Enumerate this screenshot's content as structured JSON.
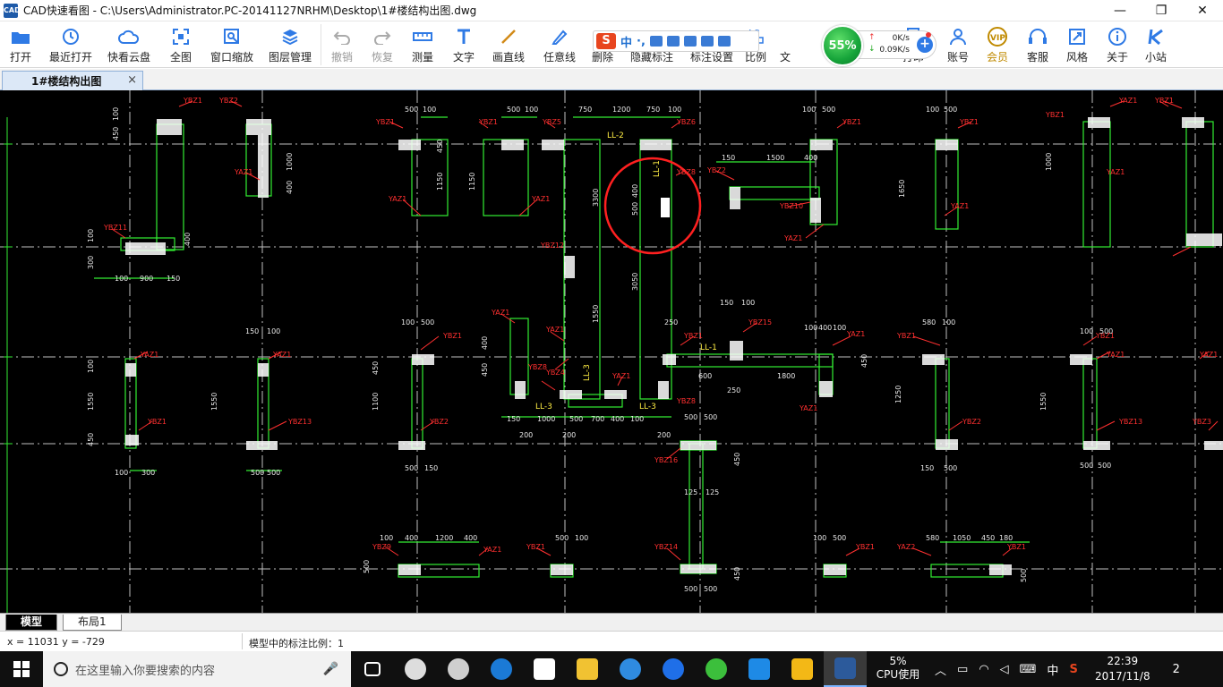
{
  "window": {
    "icon_text": "CAD",
    "title": "CAD快速看图 - C:\\Users\\Administrator.PC-20141127NRHM\\Desktop\\1#楼结构出图.dwg",
    "minimize": "—",
    "maximize": "❐",
    "close": "✕"
  },
  "toolbar": {
    "items": [
      {
        "name": "open",
        "label": "打开",
        "icon": "folder-icon",
        "disabled": false
      },
      {
        "name": "recent",
        "label": "最近打开",
        "icon": "history-icon",
        "disabled": false
      },
      {
        "name": "cloud",
        "label": "快看云盘",
        "icon": "cloud-icon",
        "disabled": false
      },
      {
        "name": "fullview",
        "label": "全图",
        "icon": "fullview-icon",
        "disabled": false
      },
      {
        "name": "window-zoom",
        "label": "窗口缩放",
        "icon": "window-zoom-icon",
        "disabled": false
      },
      {
        "name": "layers",
        "label": "图层管理",
        "icon": "layers-icon",
        "disabled": false
      },
      {
        "name": "undo",
        "label": "撤销",
        "icon": "undo-icon",
        "disabled": true
      },
      {
        "name": "redo",
        "label": "恢复",
        "icon": "redo-icon",
        "disabled": true
      },
      {
        "name": "measure",
        "label": "测量",
        "icon": "ruler-icon",
        "disabled": false
      },
      {
        "name": "text",
        "label": "文字",
        "icon": "text-icon",
        "disabled": false
      },
      {
        "name": "line",
        "label": "画直线",
        "icon": "line-icon",
        "disabled": false
      },
      {
        "name": "freeline",
        "label": "任意线",
        "icon": "pen-icon",
        "disabled": false
      },
      {
        "name": "delete",
        "label": "删除",
        "icon": "delete-icon",
        "disabled": false
      },
      {
        "name": "hide-dim",
        "label": "隐藏标注",
        "icon": "hide-icon",
        "disabled": false
      },
      {
        "name": "dim-settings",
        "label": "标注设置",
        "icon": "settings-icon",
        "disabled": false
      },
      {
        "name": "scale",
        "label": "比例",
        "icon": "scale-icon",
        "disabled": false
      }
    ],
    "right_items": [
      {
        "name": "print",
        "label": "打印",
        "icon": "printer-icon"
      },
      {
        "name": "account",
        "label": "账号",
        "icon": "user-icon"
      },
      {
        "name": "vip",
        "label": "会员",
        "icon": "vip-icon"
      },
      {
        "name": "support",
        "label": "客服",
        "icon": "headset-icon"
      },
      {
        "name": "style",
        "label": "风格",
        "icon": "style-icon"
      },
      {
        "name": "about",
        "label": "关于",
        "icon": "info-icon"
      },
      {
        "name": "site",
        "label": "小站",
        "icon": "k-icon"
      }
    ],
    "partial_label": "文"
  },
  "ime": {
    "logo": "S",
    "mode": "中",
    "punct": "·,"
  },
  "network": {
    "percent": "55%",
    "upload": "0K/s",
    "download": "0.09K/s",
    "up_arrow": "↑",
    "down_arrow": "↓",
    "plus": "+"
  },
  "document_tab": {
    "label": "1#楼结构出图",
    "close": "×"
  },
  "drawing": {
    "member_labels": [
      "YBZ1",
      "YBZ2",
      "YBZ5",
      "YBZ6",
      "YBZ8",
      "YBZ10",
      "YBZ11",
      "YBZ12",
      "YBZ13",
      "YBZ14",
      "YBZ15",
      "YBZ16",
      "YAZ1",
      "YAZ2",
      "YBZ4",
      "YBZ9"
    ],
    "beam_labels": [
      "LL-1",
      "LL-2",
      "LL-3"
    ],
    "dims": [
      "100",
      "150",
      "200",
      "250",
      "300",
      "400",
      "450",
      "500",
      "580",
      "600",
      "700",
      "750",
      "900",
      "1000",
      "1050",
      "1200",
      "1500",
      "1800",
      "3050",
      "3300"
    ]
  },
  "layout_tabs": {
    "model": "模型",
    "layout1": "布局1"
  },
  "status": {
    "coords": "x = 11031  y = -729",
    "scale_text": "模型中的标注比例：1"
  },
  "taskbar": {
    "search_placeholder": "在这里输入你要搜索的内容",
    "cpu_percent": "5%",
    "cpu_label": "CPU使用",
    "ime_lang": "中",
    "time": "22:39",
    "date": "2017/11/8",
    "notification_count": "2"
  }
}
